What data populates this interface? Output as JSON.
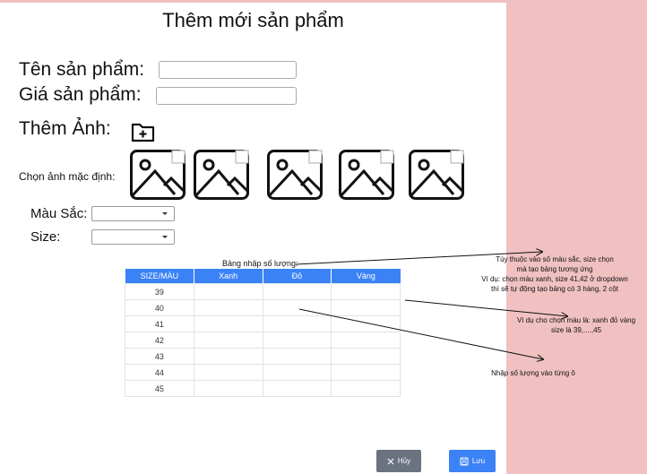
{
  "page": {
    "title": "Thêm mới sản phẩm",
    "fields": {
      "name_label": "Tên sản phẩm:",
      "name_value": "",
      "price_label": "Giá sản phẩm:",
      "price_value": ""
    },
    "add_image_label": "Thêm Ảnh:",
    "default_image_label": "Chọn ảnh mặc định:",
    "color_label": "Màu Sắc:",
    "color_value": "",
    "size_label": "Size:",
    "size_value": "",
    "table_caption": "Bảng nhập số lượng:",
    "table": {
      "headers": [
        "SIZE/MÀU",
        "Xanh",
        "Đỏ",
        "Vàng"
      ],
      "rows": [
        "39",
        "40",
        "41",
        "42",
        "43",
        "44",
        "45"
      ]
    },
    "buttons": {
      "cancel": "Hủy",
      "save": "Lưu"
    },
    "icons": [
      "folder-plus-icon",
      "image-placeholder-icon",
      "close-icon",
      "save-icon"
    ]
  },
  "annotations": {
    "note1": [
      "Tùy thuộc vào số màu sắc, size chọn",
      "mà tạo bảng tương ứng",
      "Ví dụ: chọn màu xanh, size 41,42 ở dropdown",
      "thì sẽ tự động tạo bảng có 3 hàng, 2 cột"
    ],
    "note2": [
      "Ví dụ cho chọn màu là: xanh đỏ vàng",
      "size là 39,....,45"
    ],
    "note3": "Nhập số lượng vào từng ô"
  },
  "colors": {
    "side_panel": "#f1c1c1",
    "table_header": "#3b82f6",
    "save_button": "#3b82f6",
    "cancel_button": "#6b7280"
  }
}
